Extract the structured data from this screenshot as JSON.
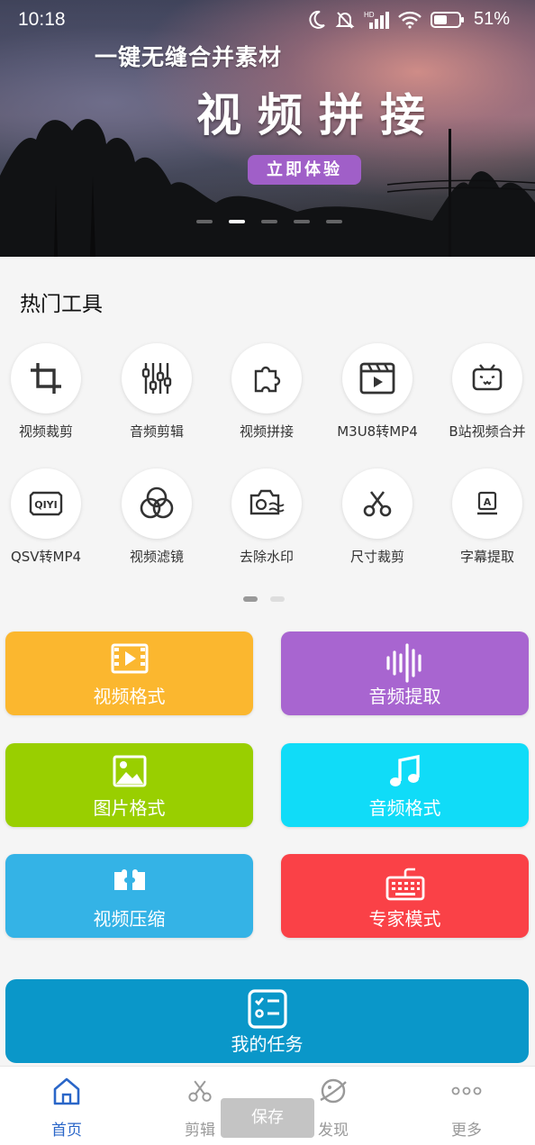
{
  "status_bar": {
    "time": "10:18",
    "network_badge": "HD",
    "battery": "51%"
  },
  "banner": {
    "tagline": "一键无缝合并素材",
    "title": "视频拼接",
    "cta_label": "立即体验",
    "cta_color": "#a05fc8",
    "dots_count": 5,
    "active_dot": 1
  },
  "hot_tools": {
    "title": "热门工具",
    "items": [
      {
        "label": "视频裁剪",
        "icon": "crop-icon"
      },
      {
        "label": "音频剪辑",
        "icon": "sliders-icon"
      },
      {
        "label": "视频拼接",
        "icon": "puzzle-icon"
      },
      {
        "label": "M3U8转MP4",
        "icon": "clapperboard-icon"
      },
      {
        "label": "B站视频合并",
        "icon": "bilibili-icon"
      },
      {
        "label": "QSV转MP4",
        "icon": "iqiyi-icon"
      },
      {
        "label": "视频滤镜",
        "icon": "filter-circles-icon"
      },
      {
        "label": "去除水印",
        "icon": "camera-watermark-icon"
      },
      {
        "label": "尺寸裁剪",
        "icon": "scissors-icon"
      },
      {
        "label": "字幕提取",
        "icon": "subtitle-icon"
      }
    ],
    "page_dots": 2,
    "active_page": 0
  },
  "features": [
    {
      "label": "视频格式",
      "color": "#fbb72f",
      "icon": "film-icon"
    },
    {
      "label": "音频提取",
      "color": "#a865d0",
      "icon": "waveform-icon"
    },
    {
      "label": "图片格式",
      "color": "#99cf00",
      "icon": "image-icon"
    },
    {
      "label": "音频格式",
      "color": "#10dcf8",
      "icon": "music-note-icon"
    },
    {
      "label": "视频压缩",
      "color": "#34b3e6",
      "icon": "compress-icon"
    },
    {
      "label": "专家模式",
      "color": "#fa4147",
      "icon": "keyboard-icon"
    }
  ],
  "task_card": {
    "label": "我的任务",
    "color": "#0a97c9",
    "icon": "checklist-icon"
  },
  "bottom_nav": {
    "items": [
      {
        "label": "首页",
        "icon": "home-icon",
        "active": true
      },
      {
        "label": "剪辑",
        "icon": "scissors-icon",
        "active": false
      },
      {
        "label": "发现",
        "icon": "planet-icon",
        "active": false
      },
      {
        "label": "更多",
        "icon": "more-dots-icon",
        "active": false
      }
    ],
    "active_color": "#2a66c8"
  },
  "toast": {
    "label": "保存"
  }
}
